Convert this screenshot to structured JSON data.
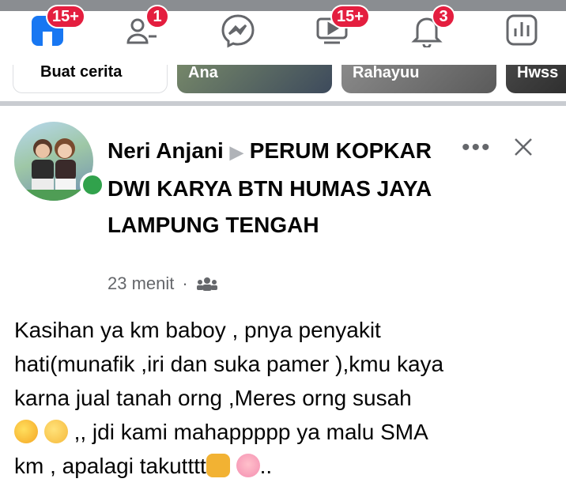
{
  "nav": {
    "items": [
      {
        "name": "home-icon",
        "badge": "15+"
      },
      {
        "name": "friends-icon",
        "badge": "1"
      },
      {
        "name": "messenger-icon",
        "badge": ""
      },
      {
        "name": "video-icon",
        "badge": "15+"
      },
      {
        "name": "bell-icon",
        "badge": "3"
      },
      {
        "name": "menu-icon",
        "badge": ""
      }
    ]
  },
  "stories": [
    {
      "label": "Buat cerita"
    },
    {
      "label": "Ana"
    },
    {
      "label": "Rahayuu"
    },
    {
      "label": "Hwss"
    }
  ],
  "post": {
    "author": "Neri Anjani",
    "group": "PERUM KOPKAR DWI KARYA BTN HUMAS JAYA LAMPUNG TENGAH",
    "time": "23 menit",
    "audience_icon": "group-icon",
    "lines": [
      "Kasihan ya km baboy , pnya penyakit",
      "hati(munafik ,iri dan suka pamer ),kmu kaya",
      "karna jual tanah orng ,Meres orng susah",
      ",, jdi kami mahappppp ya malu SMA",
      "km , apalagi takutttt",
      ".."
    ]
  },
  "colors": {
    "badge": "#e41e3f",
    "online": "#31a24c",
    "muted": "#65676b",
    "blue": "#1877f2"
  }
}
